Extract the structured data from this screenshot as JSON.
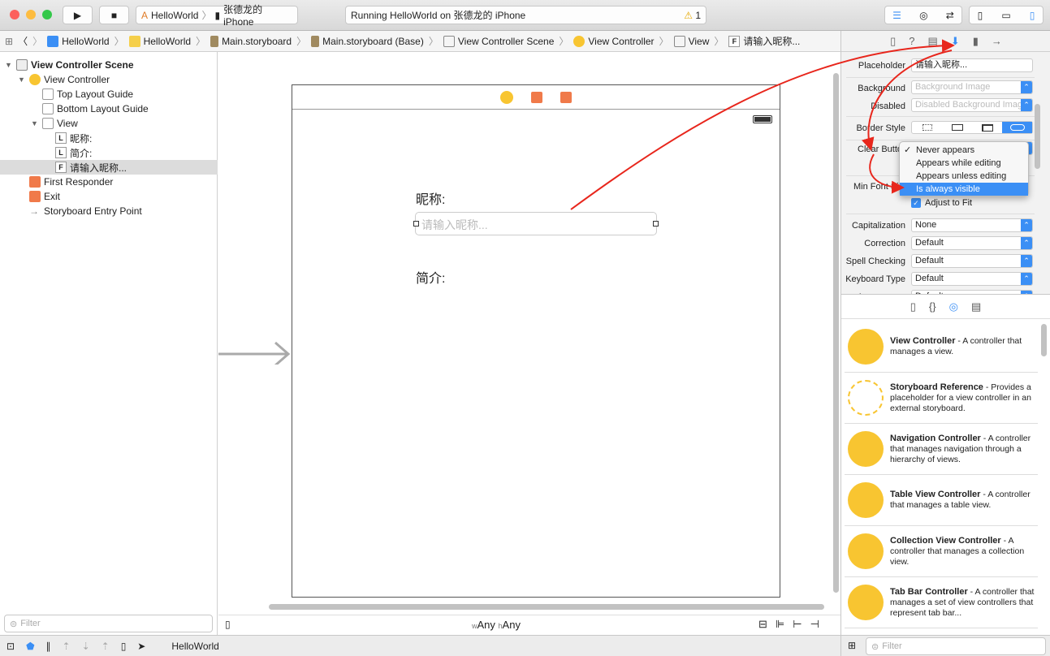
{
  "toolbar": {
    "scheme": "HelloWorld",
    "device": "张德龙的 iPhone",
    "status": "Running HelloWorld on 张德龙的 iPhone",
    "warning_count": "1"
  },
  "jumpbar": [
    "HelloWorld",
    "HelloWorld",
    "Main.storyboard",
    "Main.storyboard (Base)",
    "View Controller Scene",
    "View Controller",
    "View",
    "F",
    "请输入昵称..."
  ],
  "navigator": {
    "items": [
      {
        "label": "View Controller Scene",
        "depth": 0,
        "disclosure": "open",
        "bold": true,
        "icon": "scene-icon"
      },
      {
        "label": "View Controller",
        "depth": 1,
        "disclosure": "open",
        "icon": "view-controller-icon"
      },
      {
        "label": "Top Layout Guide",
        "depth": 2,
        "icon": "layout-guide-icon"
      },
      {
        "label": "Bottom Layout Guide",
        "depth": 2,
        "icon": "layout-guide-icon"
      },
      {
        "label": "View",
        "depth": 2,
        "disclosure": "open",
        "icon": "view-icon"
      },
      {
        "label": "昵称:",
        "depth": 3,
        "badge": "L"
      },
      {
        "label": "简介:",
        "depth": 3,
        "badge": "L"
      },
      {
        "label": "请输入昵称...",
        "depth": 3,
        "badge": "F",
        "selected": true
      },
      {
        "label": "First Responder",
        "depth": 1,
        "icon": "first-responder-icon"
      },
      {
        "label": "Exit",
        "depth": 1,
        "icon": "exit-icon"
      },
      {
        "label": "Storyboard Entry Point",
        "depth": 1,
        "icon": "arrow-icon"
      }
    ],
    "filter_placeholder": "Filter"
  },
  "canvas": {
    "label_nickname": "昵称:",
    "field_placeholder": "请输入昵称...",
    "label_intro": "简介:",
    "size_class_w": "w",
    "size_class_w_val": "Any",
    "size_class_h": "h",
    "size_class_h_val": "Any"
  },
  "debug": {
    "target": "HelloWorld"
  },
  "inspector": {
    "placeholder_label": "Placeholder",
    "placeholder_value": "请输入昵称...",
    "background_label": "Background",
    "background_value": "Background Image",
    "disabled_label": "Disabled",
    "disabled_value": "Disabled Background Image",
    "border_label": "Border Style",
    "clear_label": "Clear Button",
    "min_font_label": "Min Font Size",
    "adjust_label": "Adjust to Fit",
    "adjust_checked": true,
    "rows": [
      {
        "label": "Capitalization",
        "value": "None"
      },
      {
        "label": "Correction",
        "value": "Default"
      },
      {
        "label": "Spell Checking",
        "value": "Default"
      },
      {
        "label": "Keyboard Type",
        "value": "Default"
      },
      {
        "label": "Appearance",
        "value": "Default"
      }
    ],
    "menu": [
      {
        "label": "Never appears",
        "checked": true
      },
      {
        "label": "Appears while editing"
      },
      {
        "label": "Appears unless editing"
      },
      {
        "label": "Is always visible",
        "highlighted": true
      }
    ]
  },
  "library": {
    "items": [
      {
        "title": "View Controller",
        "desc": " - A controller that manages a view."
      },
      {
        "title": "Storyboard Reference",
        "desc": " - Provides a placeholder for a view controller in an external storyboard."
      },
      {
        "title": "Navigation Controller",
        "desc": " - A controller that manages navigation through a hierarchy of views."
      },
      {
        "title": "Table View Controller",
        "desc": " - A controller that manages a table view."
      },
      {
        "title": "Collection View Controller",
        "desc": " - A controller that manages a collection view."
      },
      {
        "title": "Tab Bar Controller",
        "desc": " - A controller that manages a set of view controllers that represent tab bar..."
      }
    ],
    "filter_placeholder": "Filter"
  },
  "colors": {
    "accent": "#3b8ff5",
    "annotation": "#e8261c",
    "library_icon": "#f8c531"
  }
}
